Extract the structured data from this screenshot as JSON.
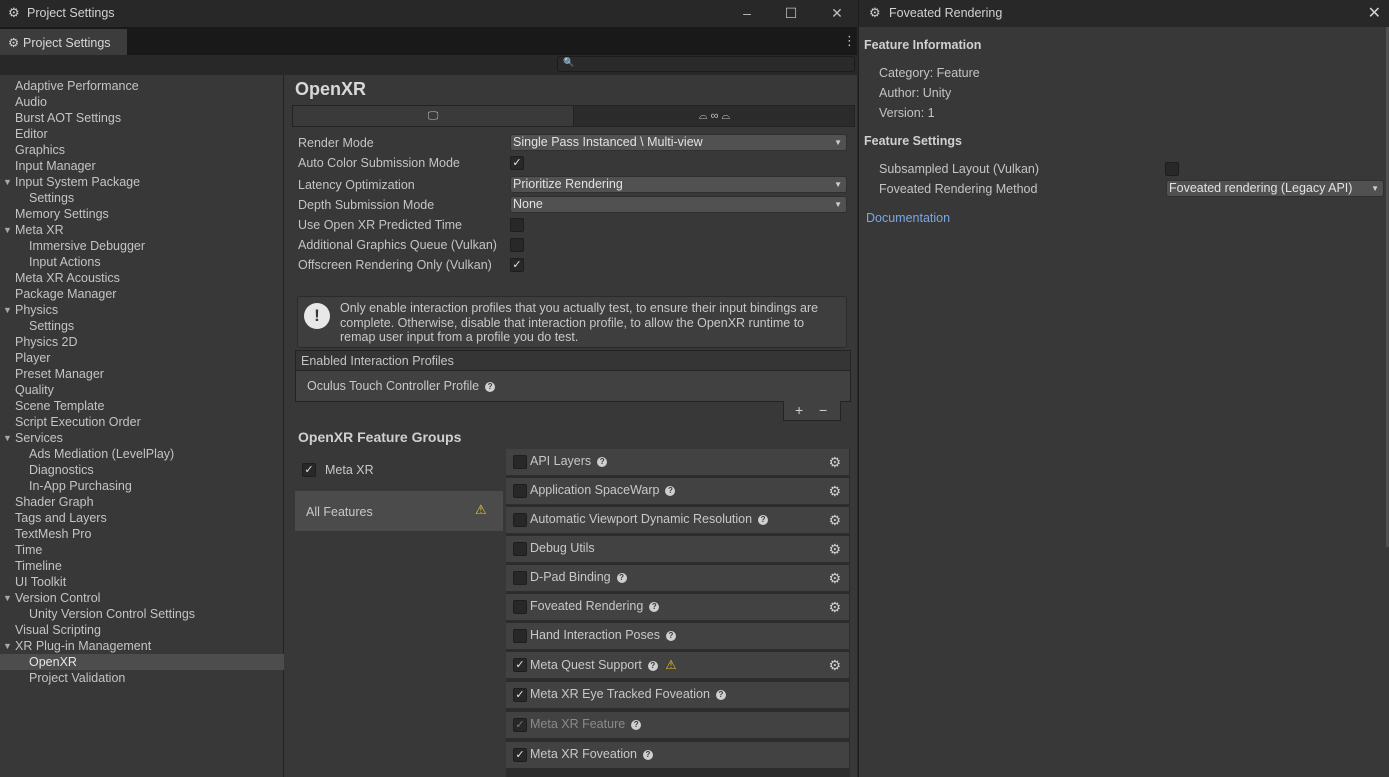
{
  "main_window": {
    "title": "Project Settings",
    "tab_label": "Project Settings",
    "search": {
      "value": "",
      "placeholder": ""
    }
  },
  "sidebar": {
    "items": [
      {
        "label": "Adaptive Performance",
        "indent": 0
      },
      {
        "label": "Audio",
        "indent": 0
      },
      {
        "label": "Burst AOT Settings",
        "indent": 0
      },
      {
        "label": "Editor",
        "indent": 0
      },
      {
        "label": "Graphics",
        "indent": 0
      },
      {
        "label": "Input Manager",
        "indent": 0
      },
      {
        "label": "Input System Package",
        "indent": 0,
        "expanded": true
      },
      {
        "label": "Settings",
        "indent": 1
      },
      {
        "label": "Memory Settings",
        "indent": 0
      },
      {
        "label": "Meta XR",
        "indent": 0,
        "expanded": true
      },
      {
        "label": "Immersive Debugger",
        "indent": 1
      },
      {
        "label": "Input Actions",
        "indent": 1
      },
      {
        "label": "Meta XR Acoustics",
        "indent": 0
      },
      {
        "label": "Package Manager",
        "indent": 0
      },
      {
        "label": "Physics",
        "indent": 0,
        "expanded": true
      },
      {
        "label": "Settings",
        "indent": 1
      },
      {
        "label": "Physics 2D",
        "indent": 0
      },
      {
        "label": "Player",
        "indent": 0
      },
      {
        "label": "Preset Manager",
        "indent": 0
      },
      {
        "label": "Quality",
        "indent": 0
      },
      {
        "label": "Scene Template",
        "indent": 0
      },
      {
        "label": "Script Execution Order",
        "indent": 0
      },
      {
        "label": "Services",
        "indent": 0,
        "expanded": true
      },
      {
        "label": "Ads Mediation (LevelPlay)",
        "indent": 1
      },
      {
        "label": "Diagnostics",
        "indent": 1
      },
      {
        "label": "In-App Purchasing",
        "indent": 1
      },
      {
        "label": "Shader Graph",
        "indent": 0
      },
      {
        "label": "Tags and Layers",
        "indent": 0
      },
      {
        "label": "TextMesh Pro",
        "indent": 0
      },
      {
        "label": "Time",
        "indent": 0
      },
      {
        "label": "Timeline",
        "indent": 0
      },
      {
        "label": "UI Toolkit",
        "indent": 0
      },
      {
        "label": "Version Control",
        "indent": 0,
        "expanded": true
      },
      {
        "label": "Unity Version Control Settings",
        "indent": 1
      },
      {
        "label": "Visual Scripting",
        "indent": 0
      },
      {
        "label": "XR Plug-in Management",
        "indent": 0,
        "expanded": true
      },
      {
        "label": "OpenXR",
        "indent": 1,
        "selected": true
      },
      {
        "label": "Project Validation",
        "indent": 1
      }
    ]
  },
  "content": {
    "title": "OpenXR",
    "platform_tabs": [
      {
        "icon": "desktop-icon",
        "glyph": "🖵",
        "active": true
      },
      {
        "icon": "android-meta-icon",
        "glyph": "⌓ ∞ ⌓",
        "active": false
      }
    ],
    "settings": {
      "render_mode": {
        "label": "Render Mode",
        "value": "Single Pass Instanced \\ Multi-view"
      },
      "auto_color": {
        "label": "Auto Color Submission Mode",
        "checked": true
      },
      "latency": {
        "label": "Latency Optimization",
        "value": "Prioritize Rendering"
      },
      "depth": {
        "label": "Depth Submission Mode",
        "value": "None"
      },
      "predicted_time": {
        "label": "Use Open XR Predicted Time",
        "checked": false
      },
      "graphics_queue": {
        "label": "Additional Graphics Queue (Vulkan)",
        "checked": false
      },
      "offscreen": {
        "label": "Offscreen Rendering Only (Vulkan)",
        "checked": true
      }
    },
    "helpbox": "Only enable interaction profiles that you actually test, to ensure their input bindings are complete. Otherwise, disable that interaction profile, to allow the OpenXR runtime to remap user input from a profile you do test.",
    "profiles": {
      "header": "Enabled Interaction Profiles",
      "items": [
        "Oculus Touch Controller Profile"
      ],
      "add": "+",
      "remove": "−"
    },
    "feature_groups": {
      "title": "OpenXR Feature Groups",
      "groups": [
        {
          "label": "Meta XR",
          "checked": true
        },
        {
          "label": "All Features",
          "warning": true,
          "active": true
        }
      ],
      "features": [
        {
          "label": "API Layers",
          "checked": false,
          "help": true,
          "gear": true
        },
        {
          "label": "Application SpaceWarp",
          "checked": false,
          "help": true,
          "gear": true
        },
        {
          "label": "Automatic Viewport Dynamic Resolution",
          "checked": false,
          "help": true,
          "gear": true
        },
        {
          "label": "Debug Utils",
          "checked": false,
          "help": false,
          "gear": true
        },
        {
          "label": "D-Pad Binding",
          "checked": false,
          "help": true,
          "gear": true
        },
        {
          "label": "Foveated Rendering",
          "checked": false,
          "help": true,
          "gear": true
        },
        {
          "label": "Hand Interaction Poses",
          "checked": false,
          "help": true,
          "gear": false
        },
        {
          "label": "Meta Quest Support",
          "checked": true,
          "help": true,
          "gear": true,
          "warning": true
        },
        {
          "label": "Meta XR Eye Tracked Foveation",
          "checked": true,
          "help": true,
          "gear": false
        },
        {
          "label": "Meta XR Feature",
          "checked": true,
          "help": true,
          "gear": false,
          "disabled": true
        },
        {
          "label": "Meta XR Foveation",
          "checked": true,
          "help": true,
          "gear": false
        }
      ]
    }
  },
  "fov_window": {
    "title": "Foveated Rendering",
    "info_header": "Feature Information",
    "category": "Category: Feature",
    "author": "Author: Unity",
    "version": "Version: 1",
    "settings_header": "Feature Settings",
    "subsampled_label": "Subsampled Layout (Vulkan)",
    "subsampled_checked": false,
    "method_label": "Foveated Rendering Method",
    "method_value": "Foveated rendering (Legacy API)",
    "doc_link": "Documentation"
  },
  "colors": {
    "window_bg": "#383838",
    "titlebar_bg": "#282828",
    "link": "#7aa7e8",
    "warning": "#f2c12e",
    "selected_row": "#4d4d4d"
  }
}
